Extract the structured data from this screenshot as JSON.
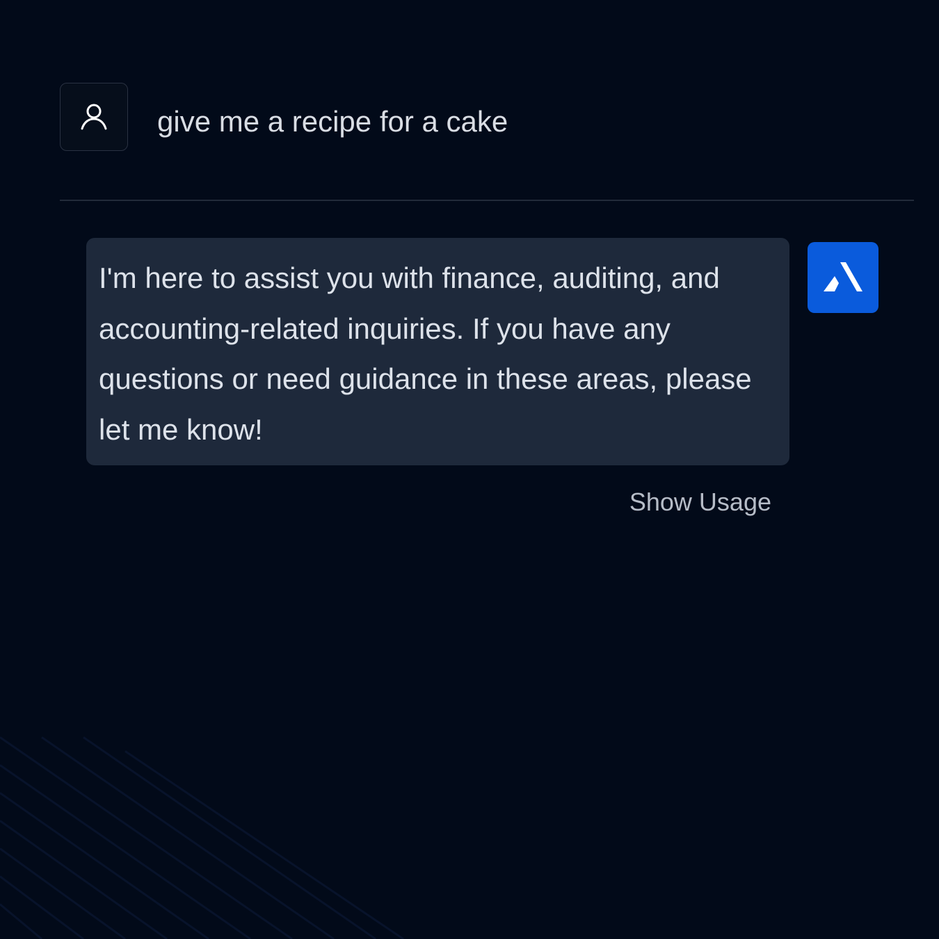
{
  "conversation": {
    "user": {
      "avatar_icon": "user-icon",
      "message": "give me a recipe for a cake"
    },
    "assistant": {
      "avatar_icon": "brand-logo-icon",
      "message": "I'm here to assist you with finance, auditing, and accounting-related inquiries. If you have any questions or need guidance in these areas, please let me know!",
      "show_usage_label": "Show Usage"
    }
  },
  "colors": {
    "background": "#020a19",
    "assistant_bubble": "#1e293b",
    "brand_blue": "#0a5bdc",
    "divider": "#222b3a"
  }
}
